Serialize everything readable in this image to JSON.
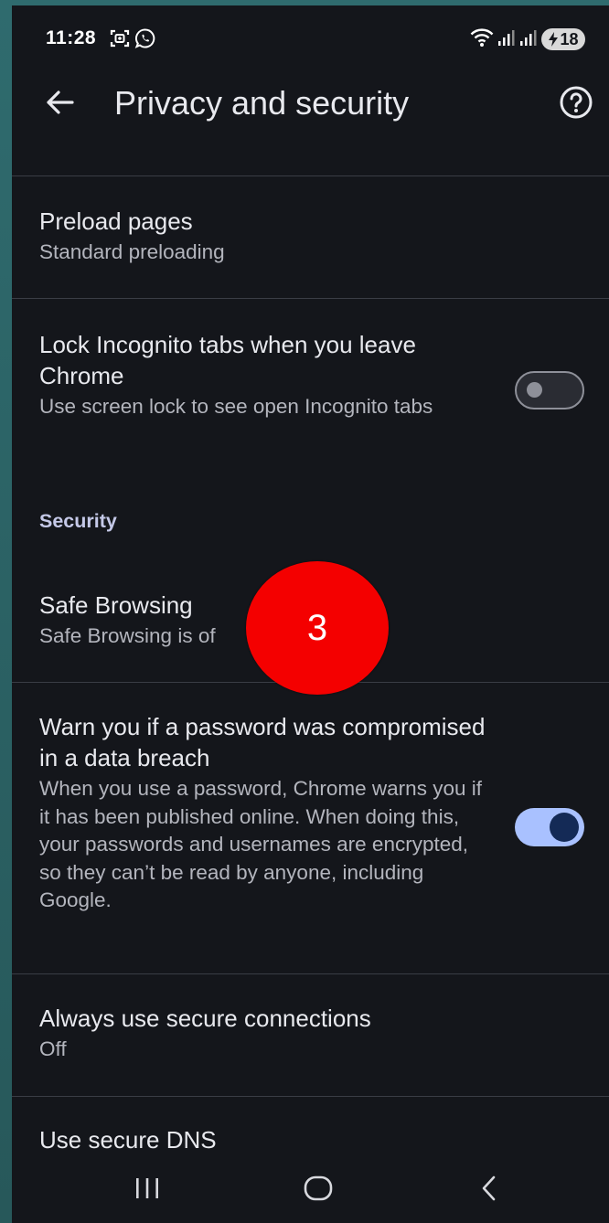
{
  "status_bar": {
    "time": "11:28",
    "battery": "18",
    "icons": [
      "screenshot-icon",
      "whatsapp-icon",
      "wifi-icon",
      "signal-icon",
      "signal-icon",
      "battery-icon"
    ]
  },
  "toolbar": {
    "title": "Privacy and security",
    "back_icon": "arrow-left-icon",
    "help_icon": "help-circle-icon"
  },
  "settings": {
    "preload": {
      "title": "Preload pages",
      "subtitle": "Standard preloading"
    },
    "lock_incognito": {
      "title": "Lock Incognito tabs when you leave Chrome",
      "subtitle": "Use screen lock to see open Incognito tabs",
      "enabled": false
    },
    "security_header": "Security",
    "safe_browsing": {
      "title": "Safe Browsing",
      "subtitle": "Safe Browsing is of"
    },
    "password_warn": {
      "title": "Warn you if a password was compromised in a data breach",
      "subtitle": "When you use a password, Chrome warns you if it has been published online. When doing this, your passwords and usernames are encrypted, so they can’t be read by anyone, including Google.",
      "enabled": true
    },
    "secure_connections": {
      "title": "Always use secure connections",
      "subtitle": "Off"
    },
    "secure_dns": {
      "title": "Use secure DNS"
    }
  },
  "overlay_badge": "3",
  "nav_bar": {
    "icons": [
      "recent-apps-icon",
      "home-icon",
      "back-icon"
    ]
  },
  "colors": {
    "background": "#14161b",
    "toggle_on": "#a9c1ff",
    "badge": "#f40000",
    "section_header": "#c5c9e8"
  }
}
